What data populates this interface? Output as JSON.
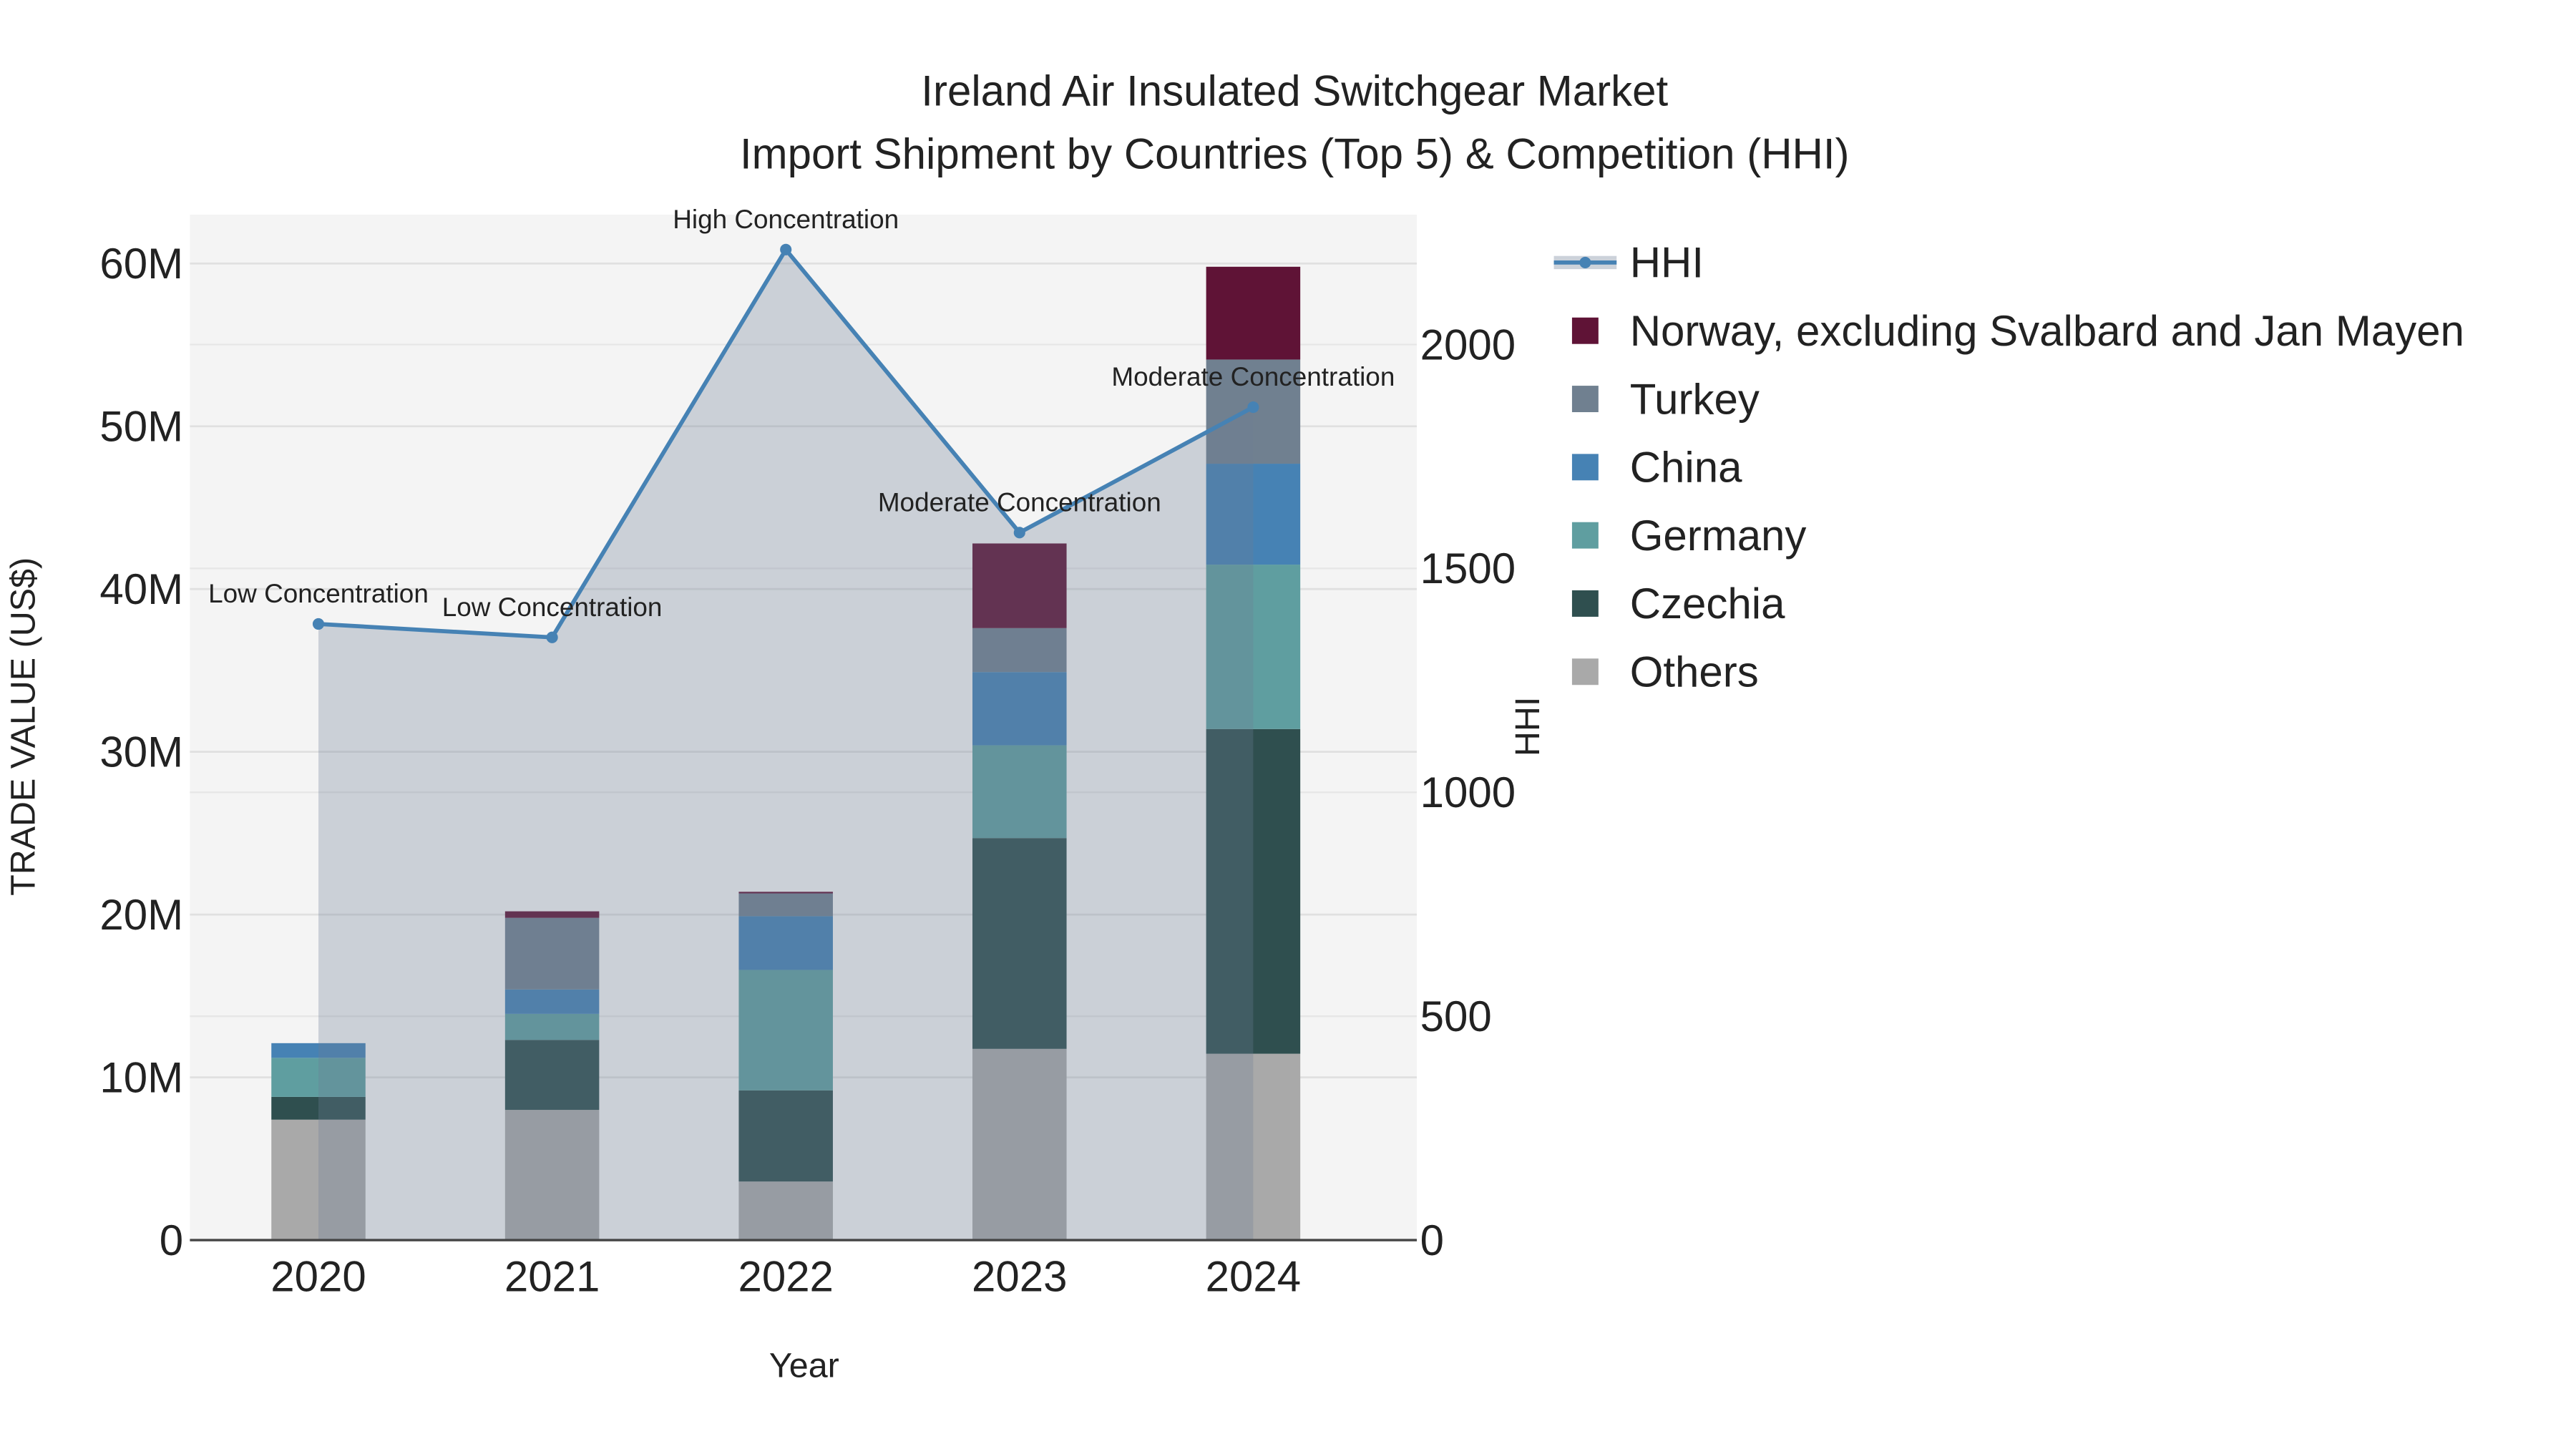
{
  "chart_data": {
    "type": "bar",
    "stacked": true,
    "title": "Ireland Air Insulated Switchgear Market",
    "subtitle": "Import Shipment by Countries (Top 5) & Competition (HHI)",
    "xlabel": "Year",
    "ylabel": "TRADE VALUE (US$)",
    "y2label": "HHI",
    "categories": [
      "2020",
      "2021",
      "2022",
      "2023",
      "2024"
    ],
    "ylim": [
      0,
      63000000
    ],
    "y_ticks": [
      0,
      10000000,
      20000000,
      30000000,
      40000000,
      50000000,
      60000000
    ],
    "y_tick_labels": [
      "0",
      "10M",
      "20M",
      "30M",
      "40M",
      "50M",
      "60M"
    ],
    "y2lim": [
      0,
      2290
    ],
    "y2_ticks": [
      0,
      500,
      1000,
      1500,
      2000
    ],
    "y2_tick_labels": [
      "0",
      "500",
      "1000",
      "1500",
      "2000"
    ],
    "grid": true,
    "legend_position": "right",
    "series": [
      {
        "name": "Others",
        "color": "#a9a9a9",
        "values": [
          7400000,
          8000000,
          3600000,
          11750000,
          11450000
        ]
      },
      {
        "name": "Czechia",
        "color": "#2f4f4f",
        "values": [
          1400000,
          4300000,
          5600000,
          12950000,
          19950000
        ]
      },
      {
        "name": "Germany",
        "color": "#5f9ea0",
        "values": [
          2400000,
          1600000,
          7400000,
          5700000,
          10100000
        ]
      },
      {
        "name": "China",
        "color": "#4682b4",
        "values": [
          900000,
          1500000,
          3300000,
          4500000,
          6200000
        ]
      },
      {
        "name": "Turkey",
        "color": "#708090",
        "values": [
          0,
          4400000,
          1400000,
          2700000,
          6400000
        ]
      },
      {
        "name": "Norway, excluding Svalbard and Jan Mayen",
        "color": "#5f1336",
        "values": [
          0,
          400000,
          100000,
          5200000,
          5700000
        ]
      }
    ],
    "hhi": {
      "name": "HHI",
      "color": "#4682b4",
      "values": [
        1376,
        1346,
        2212,
        1580,
        1860
      ],
      "annotations": [
        "Low Concentration",
        "Low Concentration",
        "High Concentration",
        "Moderate Concentration",
        "Moderate Concentration"
      ]
    },
    "legend_order": [
      "HHI",
      "Norway, excluding Svalbard and Jan Mayen",
      "Turkey",
      "China",
      "Germany",
      "Czechia",
      "Others"
    ]
  }
}
